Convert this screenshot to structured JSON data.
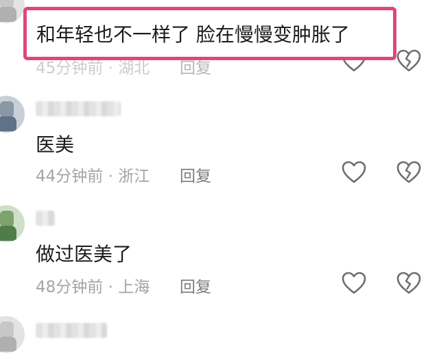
{
  "comments": [
    {
      "content": "和年轻也不一样了 脸在慢慢变肿胀了",
      "time": "45分钟前",
      "location": "湖北",
      "reply": "回复"
    },
    {
      "content": "医美",
      "time": "44分钟前",
      "location": "浙江",
      "reply": "回复"
    },
    {
      "content": "做过医美了",
      "time": "48分钟前",
      "location": "上海",
      "reply": "回复"
    }
  ],
  "meta_separator": " · ",
  "highlight_color": "#e0467a",
  "icons": {
    "like": "heart-outline-icon",
    "dislike": "broken-heart-icon"
  }
}
